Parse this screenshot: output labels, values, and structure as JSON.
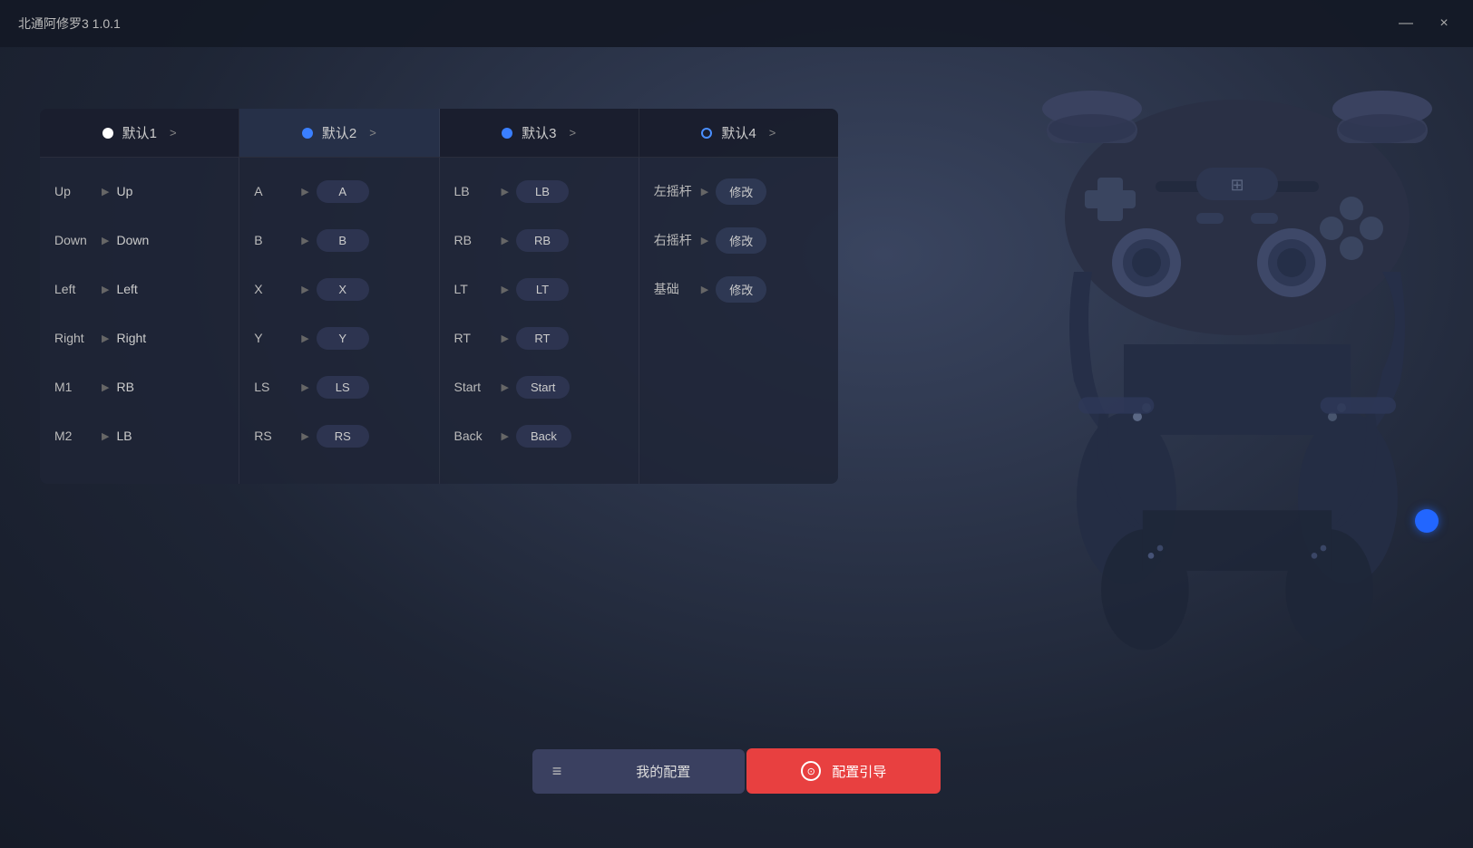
{
  "app": {
    "title": "北通阿修罗3  1.0.1",
    "minimize_label": "—",
    "close_label": "×"
  },
  "tabs": [
    {
      "id": "tab1",
      "dot": "white",
      "label": "默认1",
      "active": false
    },
    {
      "id": "tab2",
      "dot": "blue",
      "label": "默认2",
      "active": true
    },
    {
      "id": "tab3",
      "dot": "blue",
      "label": "默认3",
      "active": false
    },
    {
      "id": "tab4",
      "dot": "blue-outline",
      "label": "默认4",
      "active": false
    }
  ],
  "col1": {
    "rows": [
      {
        "label": "Up",
        "value": "Up"
      },
      {
        "label": "Down",
        "value": "Down"
      },
      {
        "label": "Left",
        "value": "Left"
      },
      {
        "label": "Right",
        "value": "Right"
      },
      {
        "label": "M1",
        "value": "RB"
      },
      {
        "label": "M2",
        "value": "LB"
      }
    ]
  },
  "col2": {
    "rows": [
      {
        "label": "A",
        "value": "A"
      },
      {
        "label": "B",
        "value": "B"
      },
      {
        "label": "X",
        "value": "X"
      },
      {
        "label": "Y",
        "value": "Y"
      },
      {
        "label": "LS",
        "value": "LS"
      },
      {
        "label": "RS",
        "value": "RS"
      }
    ]
  },
  "col3": {
    "rows": [
      {
        "label": "LB",
        "value": "LB"
      },
      {
        "label": "RB",
        "value": "RB"
      },
      {
        "label": "LT",
        "value": "LT"
      },
      {
        "label": "RT",
        "value": "RT"
      },
      {
        "label": "Start",
        "value": "Start"
      },
      {
        "label": "Back",
        "value": "Back"
      }
    ]
  },
  "col4": {
    "rows": [
      {
        "label": "左摇杆",
        "value": "修改"
      },
      {
        "label": "右摇杆",
        "value": "修改"
      },
      {
        "label": "基础",
        "value": "修改"
      }
    ]
  },
  "bottom": {
    "menu_icon": "≡",
    "my_config_label": "我的配置",
    "guide_label": "配置引导",
    "guide_icon": "⊙"
  }
}
